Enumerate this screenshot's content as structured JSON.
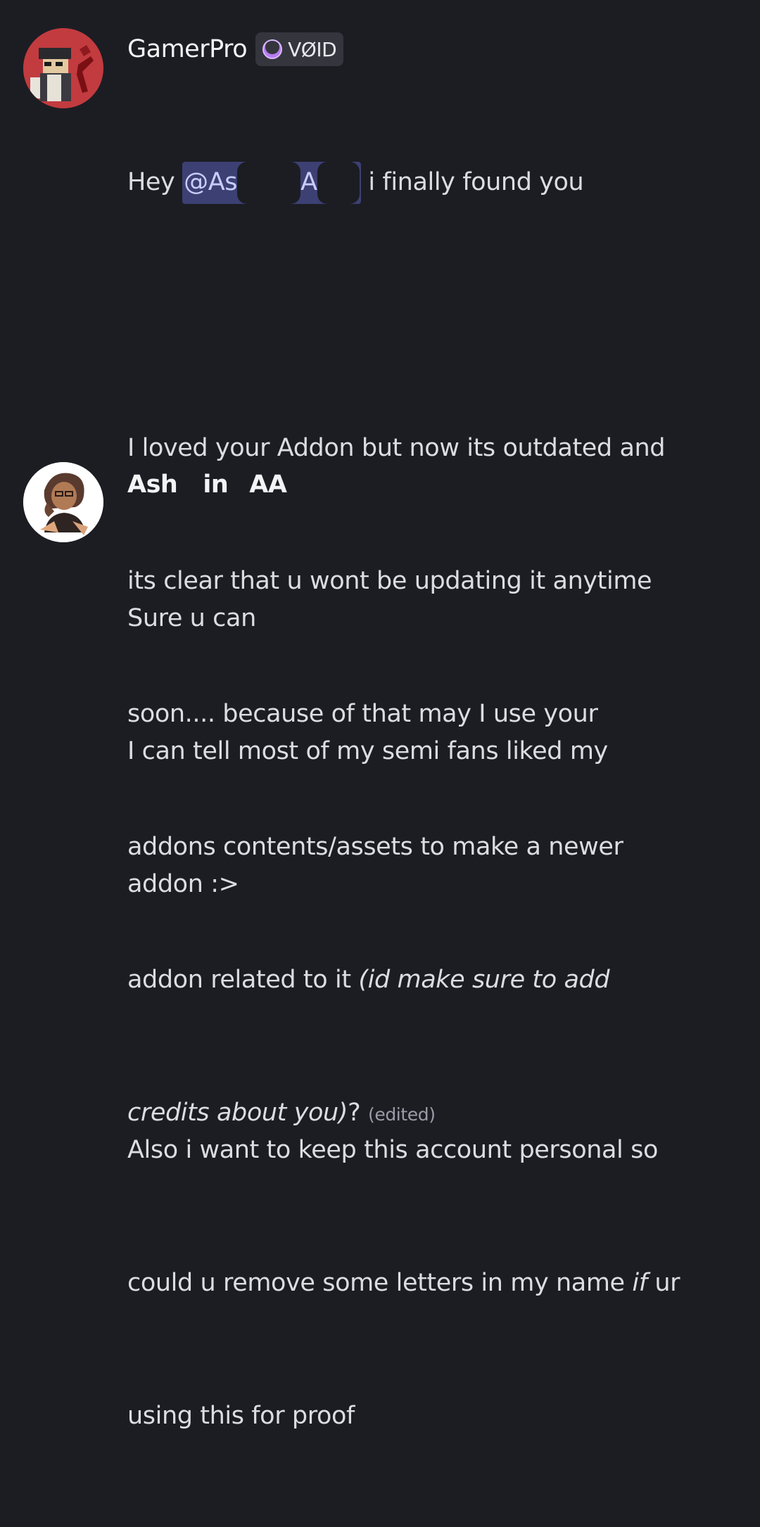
{
  "messages": [
    {
      "username": "GamerPro",
      "tag": {
        "icon": "purple-moon-icon",
        "label": "VØID"
      },
      "mention_visible_start": "@As",
      "mention_visible_mid": "A",
      "line1_rest": "i finally found you",
      "greeting": "Hey",
      "lines": [
        "I loved your Addon but now its outdated and",
        "its clear that u wont be updating it anytime",
        "soon.... because of that may I use your",
        "addons contents/assets to make a newer"
      ],
      "line_addon_plain": "addon related to it ",
      "line_addon_italic": "(id make sure to add",
      "line_credits_italic": "credits about you)",
      "line_credits_plain": "?",
      "edited_label": "(edited)"
    },
    {
      "username_part1": "Ash",
      "username_part2": "in",
      "username_part3": "AA",
      "lines": [
        "Sure u can",
        "I can tell most of my semi fans liked my",
        "addon :>"
      ],
      "lines2": [
        "Also i want to keep this account personal so"
      ],
      "line_ifur_plain": "could u remove some letters in my name ",
      "line_ifur_italic": "if",
      "line_ifur_rest": " ur",
      "last_line": "using this for proof"
    }
  ],
  "colors": {
    "background": "#1c1d23",
    "mention_bg": "#3c4073",
    "tag_bg": "#34353d"
  }
}
